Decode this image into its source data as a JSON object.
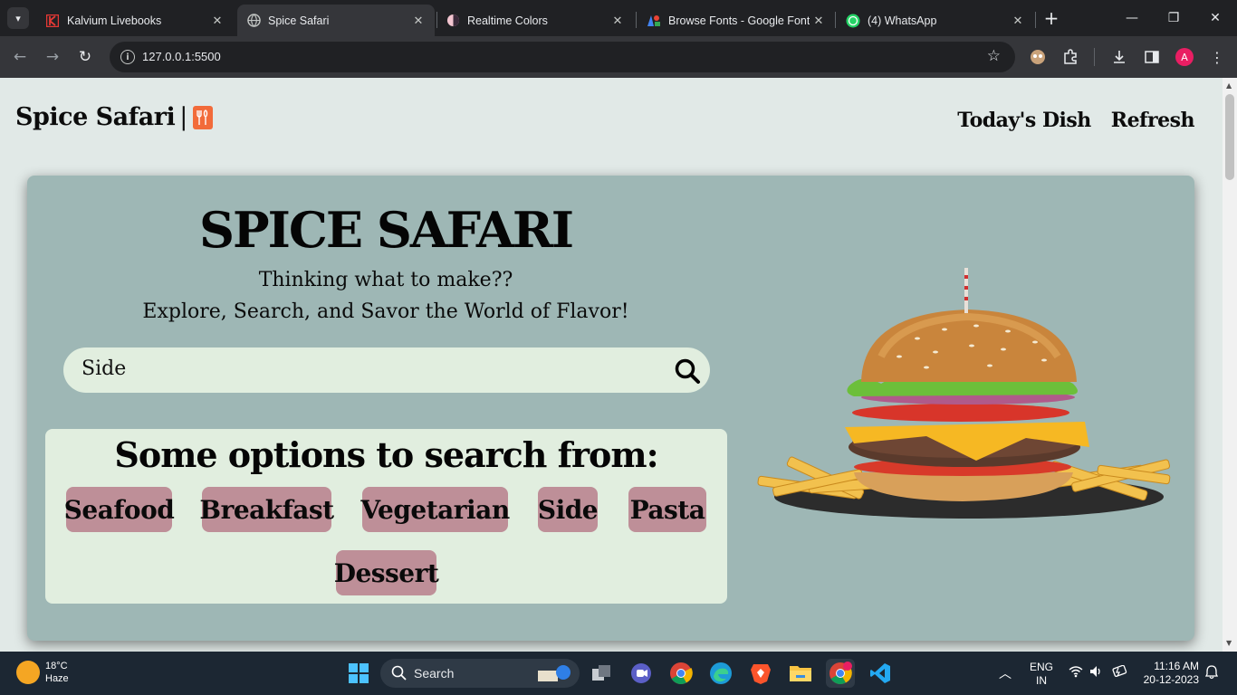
{
  "browser": {
    "tabs": [
      {
        "title": "Kalvium Livebooks",
        "active": false
      },
      {
        "title": "Spice Safari",
        "active": true
      },
      {
        "title": "Realtime Colors",
        "active": false
      },
      {
        "title": "Browse Fonts - Google Fonts",
        "active": false
      },
      {
        "title": "(4) WhatsApp",
        "active": false
      }
    ],
    "url": "127.0.0.1:5500",
    "profile_initial": "A"
  },
  "site": {
    "logo_text": "Spice Safari",
    "logo_bar": "|",
    "nav": [
      {
        "label": "Today's Dish"
      },
      {
        "label": "Refresh"
      }
    ],
    "hero": {
      "title": "SPICE SAFARI",
      "subtitle1": "Thinking what to make??",
      "subtitle2": "Explore, Search, and Savor the World of Flavor!"
    },
    "search": {
      "value": "Side"
    },
    "options": {
      "heading": "Some options to search from:",
      "chips": [
        "Seafood",
        "Breakfast",
        "Vegetarian",
        "Side",
        "Pasta",
        "Dessert"
      ]
    }
  },
  "taskbar": {
    "weather_temp": "18°C",
    "weather_desc": "Haze",
    "search_label": "Search",
    "lang1": "ENG",
    "lang2": "IN",
    "time": "11:16 AM",
    "date": "20-12-2023"
  },
  "colors": {
    "page_bg": "#e1e9e7",
    "hero_bg": "#9eb7b5",
    "panel_bg": "#e1eedf",
    "chip_bg": "#be8f98",
    "logo_icon": "#f26b3a"
  }
}
